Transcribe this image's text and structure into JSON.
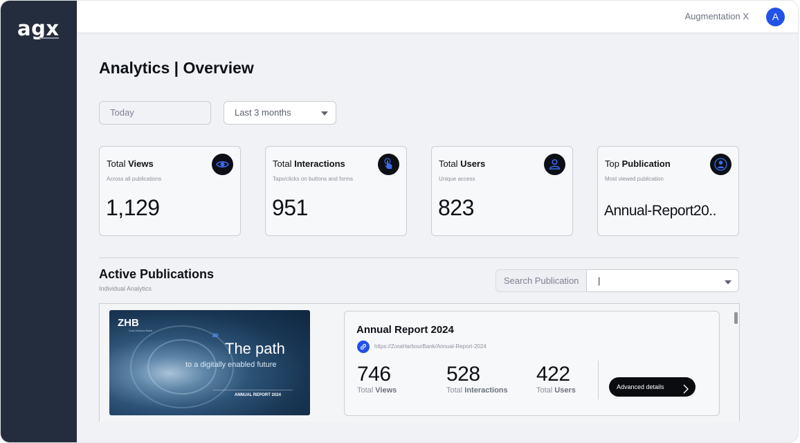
{
  "brand": {
    "logo": "agx"
  },
  "topbar": {
    "org_name": "Augmentation X",
    "avatar_initial": "A"
  },
  "page": {
    "title": "Analytics | Overview"
  },
  "filters": {
    "date_value": "Today",
    "range_value": "Last 3 months"
  },
  "stats": [
    {
      "title_prefix": "Total ",
      "title_bold": "Views",
      "subtitle": "Across all publications",
      "value": "1,129",
      "icon": "eye-icon"
    },
    {
      "title_prefix": "Total ",
      "title_bold": "Interactions",
      "subtitle": "Taps/clicks on buttons and forms",
      "value": "951",
      "icon": "tap-icon"
    },
    {
      "title_prefix": "Total ",
      "title_bold": "Users",
      "subtitle": "Unique access",
      "value": "823",
      "icon": "users-icon"
    },
    {
      "title_prefix": "Top ",
      "title_bold": "Publication",
      "subtitle": "Most viewed publication",
      "value": "Annual-Report20..",
      "icon": "user-icon"
    }
  ],
  "active": {
    "title": "Active Publications",
    "subtitle": "Individual Analytics",
    "search_label": "Search Publication",
    "search_value": "|"
  },
  "publications": [
    {
      "thumbnail": {
        "logo": "ZHB",
        "logo_sub": "Zora Harbour Bank",
        "arrows": "›››",
        "headline": "The path",
        "tagline": "to a digitally enabled future",
        "footer": "ANNUAL REPORT 2024"
      },
      "title": "Annual Report 2024",
      "url": "https://ZoraHarbourBank/Annual-Report-2024",
      "views": "746",
      "interactions": "528",
      "users": "422",
      "label_prefix": "Total ",
      "views_label": "Views",
      "interactions_label": "Interactions",
      "users_label": "Users",
      "button_label": "Advanced details"
    }
  ],
  "colors": {
    "sidebar": "#242d3e",
    "accent": "#2352e8",
    "background": "#f1f2f5"
  }
}
